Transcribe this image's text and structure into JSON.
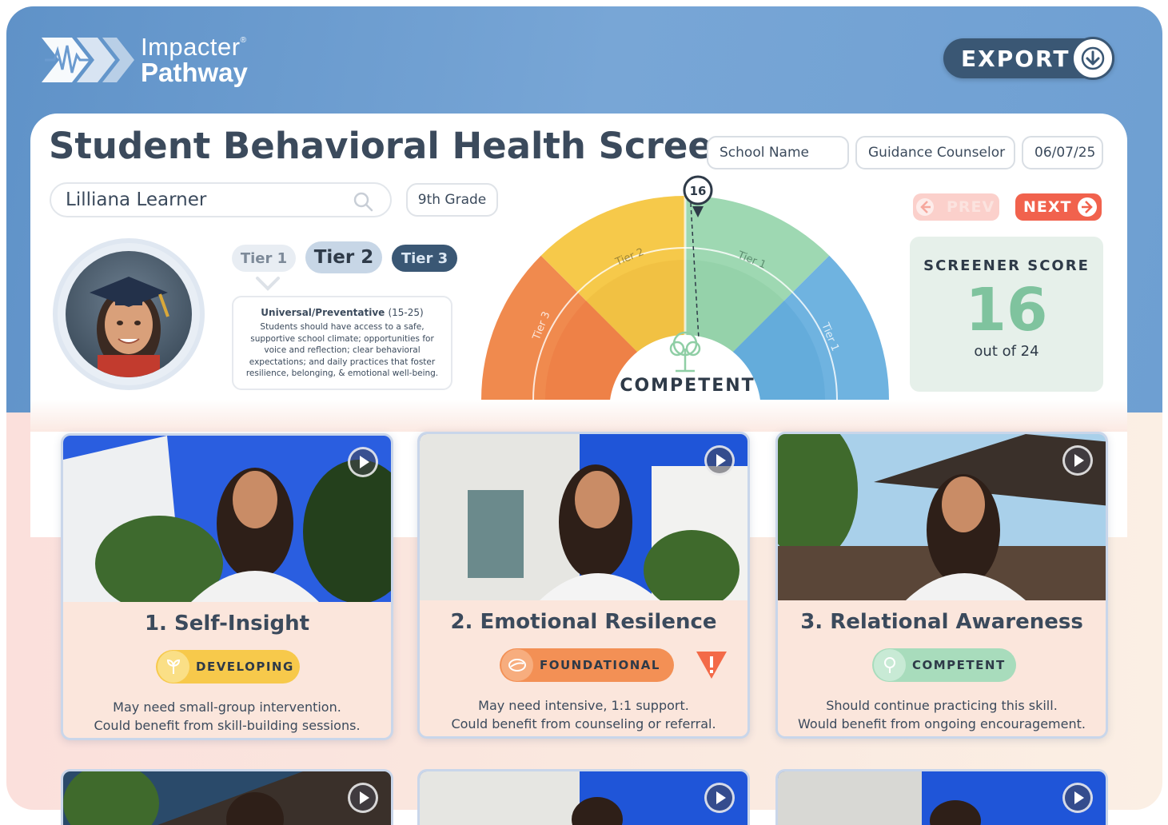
{
  "brand": {
    "line1": "Impacter",
    "line2": "Pathway",
    "reg": "®"
  },
  "export": {
    "label": "EXPORT"
  },
  "header": {
    "title": "Student Behavioral Health Screener",
    "school": "School Name",
    "counselor": "Guidance Counselor",
    "date": "06/07/25"
  },
  "student": {
    "name": "Lilliana Learner",
    "grade": "9th Grade"
  },
  "tiers": {
    "items": [
      "Tier 1",
      "Tier 2",
      "Tier 3"
    ],
    "selected": "Tier 2",
    "info_title": "Universal/Preventative",
    "info_range": "(15-25)",
    "info_desc": "Students should have access to a safe, supportive school climate; opportunities for voice and reflection; clear behavioral expectations; and daily practices that foster resilience, belonging, & emotional well-being."
  },
  "gauge": {
    "value": 16,
    "status": "COMPETENT",
    "segment_labels": [
      "Tier 3",
      "Tier 2",
      "Tier 1",
      "Tier 1"
    ],
    "colors": {
      "foundational": "#f08a4e",
      "developing": "#f6c94a",
      "competent": "#9ed8b2",
      "advanced": "#6fb3e0"
    }
  },
  "nav": {
    "prev": "PREV",
    "next": "NEXT"
  },
  "score": {
    "title": "SCREENER SCORE",
    "value": "16",
    "out_of": "out of 24"
  },
  "cards": [
    {
      "title": "1. Self-Insight",
      "badge": "DEVELOPING",
      "badge_color": "#f7c94b",
      "desc1": "May need small-group intervention.",
      "desc2": "Could benefit from skill-building sessions."
    },
    {
      "title": "2. Emotional Resilence",
      "badge": "FOUNDATIONAL",
      "badge_color": "#f39055",
      "desc1": "May need intensive, 1:1 support.",
      "desc2": "Could benefit from counseling or referral."
    },
    {
      "title": "3. Relational Awareness",
      "badge": "COMPETENT",
      "badge_color": "#a8dcbc",
      "desc1": "Should continue practicing this skill.",
      "desc2": "Would benefit from ongoing encouragement."
    }
  ]
}
